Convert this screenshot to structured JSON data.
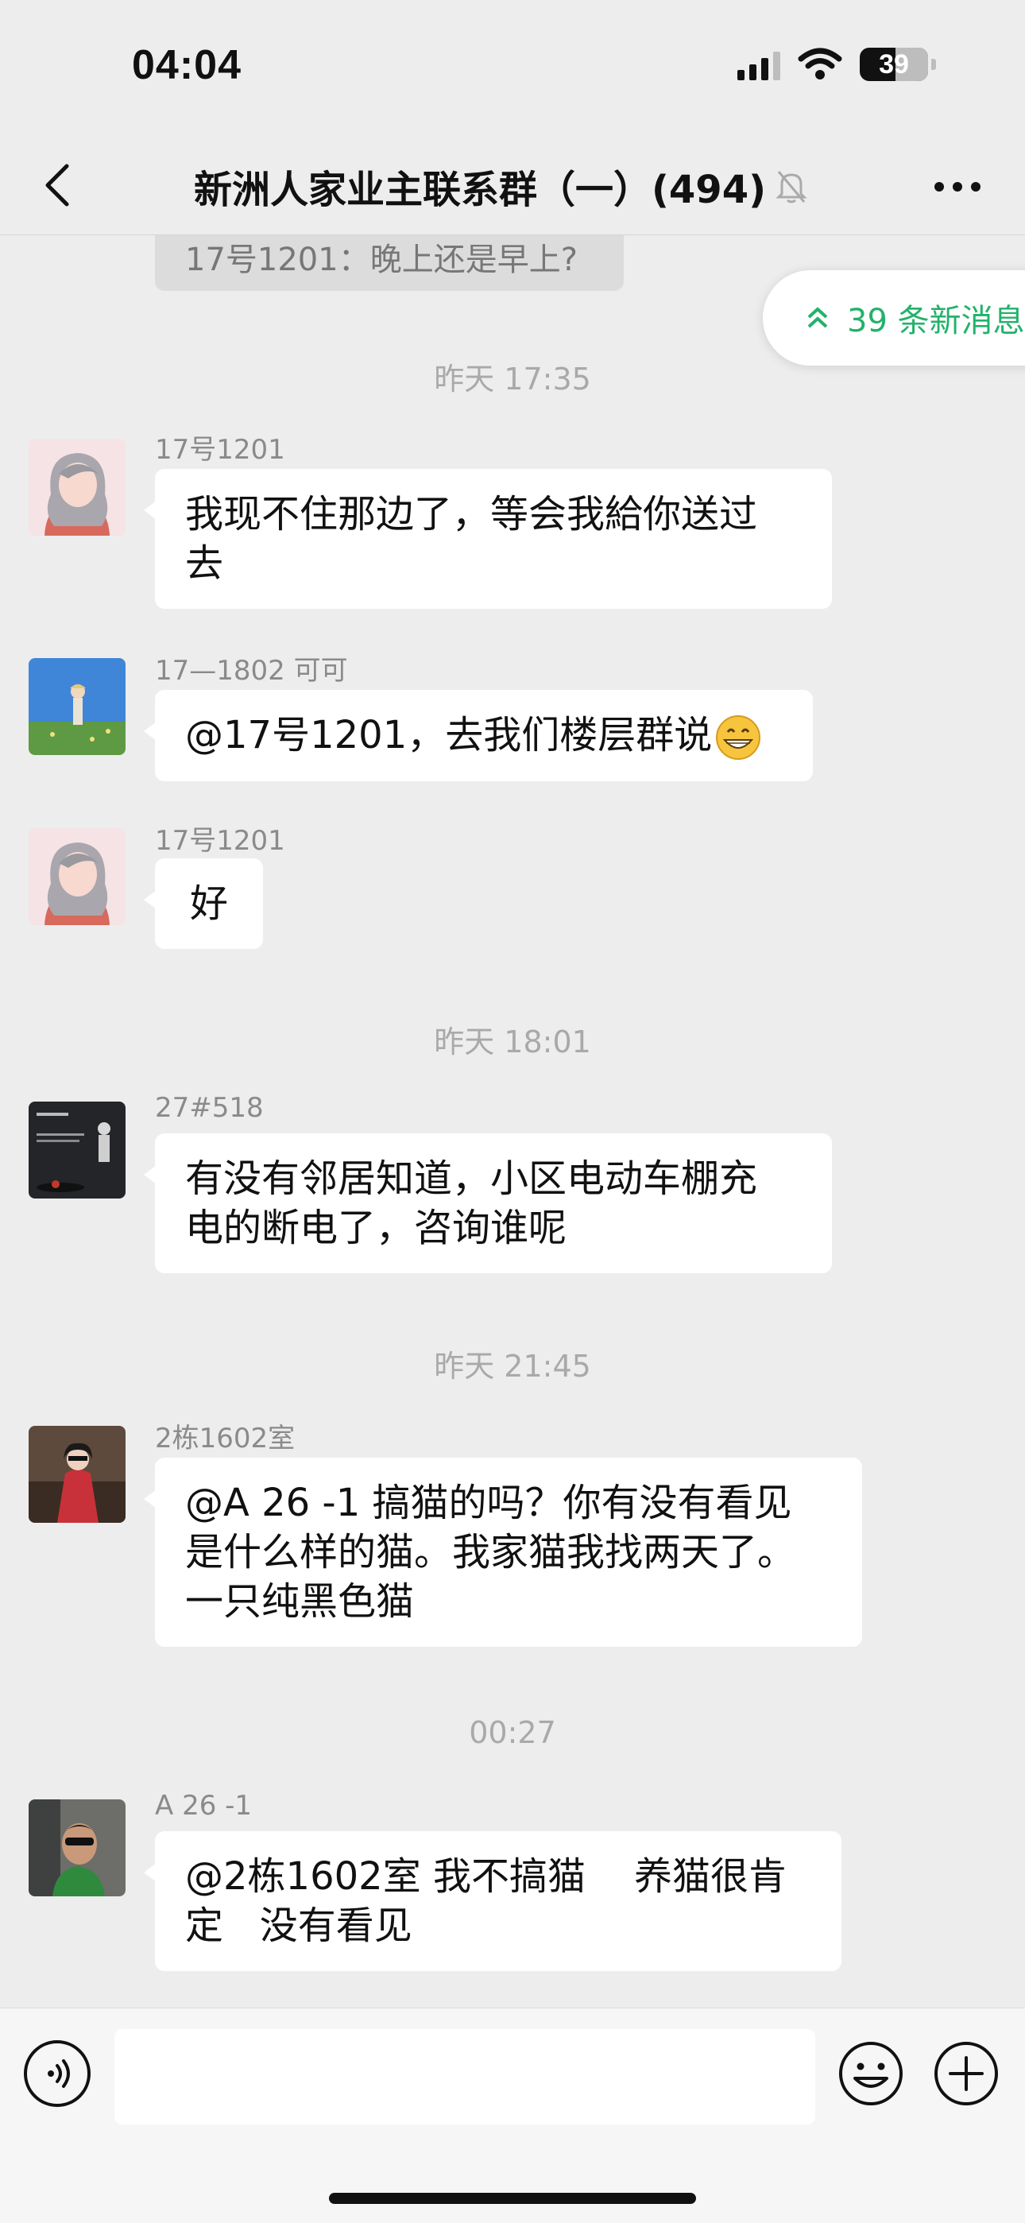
{
  "status_bar": {
    "time": "04:04",
    "battery": "39"
  },
  "header": {
    "title": "新洲人家业主联系群（一）(494)"
  },
  "quote": {
    "text": "17号1201：晚上还是早上?"
  },
  "new_messages": {
    "label": "39 条新消息"
  },
  "timestamps": [
    "昨天 17:35",
    "昨天 18:01",
    "昨天 21:45",
    "00:27"
  ],
  "messages": [
    {
      "sender": "17号1201",
      "lines": [
        "我现不住那边了，等会我給你送过",
        "去"
      ]
    },
    {
      "sender": "17—1802 可可",
      "text": "@17号1201，去我们楼层群说"
    },
    {
      "sender": "17号1201",
      "text": "好"
    },
    {
      "sender": "27#518",
      "lines": [
        "有没有邻居知道，小区电动车棚充",
        "电的断电了，咨询谁呢"
      ]
    },
    {
      "sender": "2栋1602室",
      "lines": [
        "@A  26 -1 搞猫的吗？你有没有看见",
        "是什么样的猫。我家猫我找两天了。",
        "一只纯黑色猫"
      ]
    },
    {
      "sender": "A  26 -1",
      "lines": [
        "@2栋1602室 我不搞猫    养猫很肯",
        "定   没有看见"
      ]
    }
  ],
  "input": {
    "value": ""
  },
  "icons": [
    "back-icon",
    "bell-off-icon",
    "more-icon",
    "signal-icon",
    "wifi-icon",
    "battery-icon",
    "chevron-up-icon",
    "grinning-emoji",
    "voice-icon",
    "emoji-icon",
    "plus-icon"
  ],
  "colors": {
    "background": "#ededed",
    "bubble": "#ffffff",
    "accent": "#22b26b",
    "muted": "#a9a9a9"
  }
}
